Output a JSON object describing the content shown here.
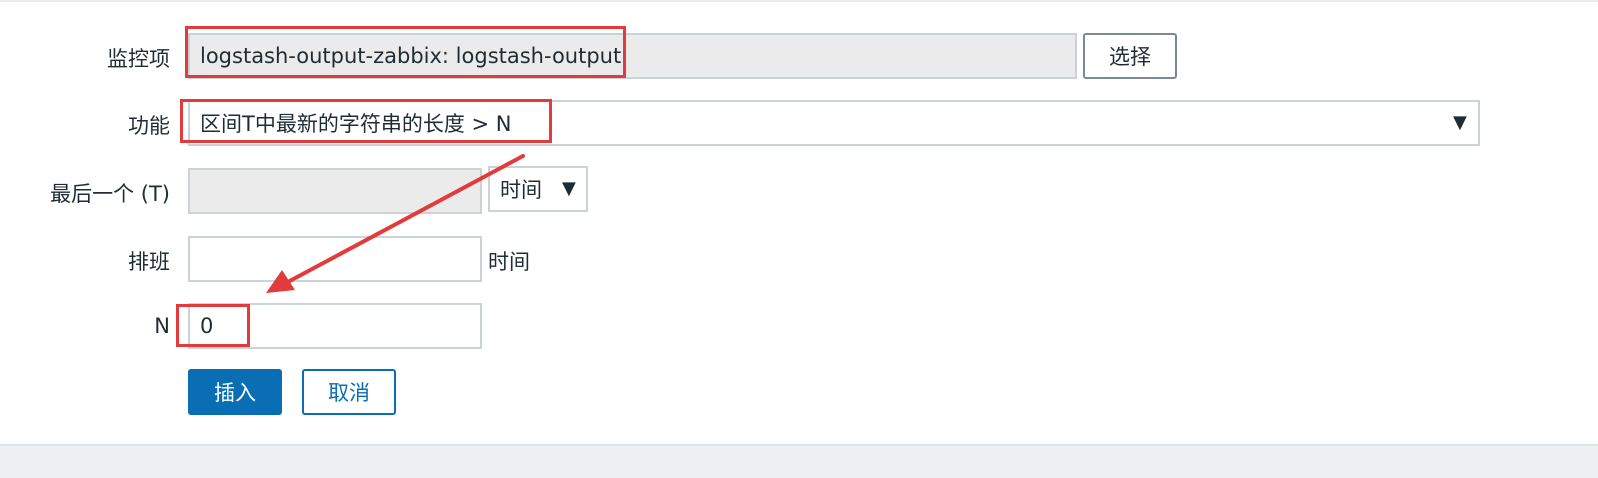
{
  "form": {
    "item_label": "监控项",
    "item_value": "logstash-output-zabbix: logstash-output",
    "select_button": "选择",
    "function_label": "功能",
    "function_value": "区间T中最新的字符串的长度 > N",
    "last_label": "最后一个 (T)",
    "last_value": "",
    "last_unit_select": "时间",
    "shift_label": "排班",
    "shift_value": "",
    "shift_unit": "时间",
    "n_label": "N",
    "n_value": "0",
    "insert_button": "插入",
    "cancel_button": "取消"
  },
  "colors": {
    "primary": "#0a6eb4",
    "annotation": "#e23b3b",
    "readonly_bg": "#ebebeb"
  },
  "icons": {
    "dropdown": "triangle-down-icon"
  }
}
